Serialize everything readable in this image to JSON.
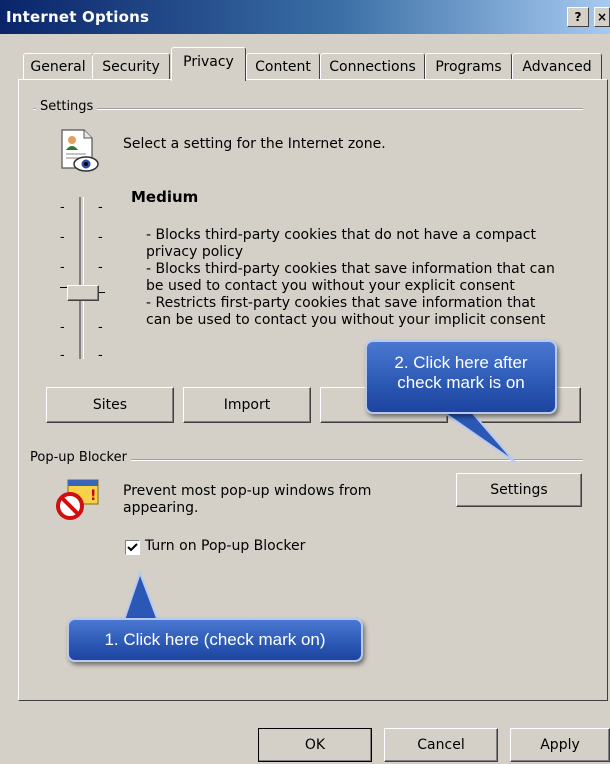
{
  "window": {
    "title": "Internet Options",
    "help_btn": "?",
    "close_btn": "×"
  },
  "tabs": [
    {
      "label": "General"
    },
    {
      "label": "Security"
    },
    {
      "label": "Privacy"
    },
    {
      "label": "Content"
    },
    {
      "label": "Connections"
    },
    {
      "label": "Programs"
    },
    {
      "label": "Advanced"
    }
  ],
  "active_tab": "Privacy",
  "settings": {
    "group_label": "Settings",
    "intro": "Select a setting for the Internet zone.",
    "level_title": "Medium",
    "desc": [
      "- Blocks third-party cookies that do not have a compact",
      "privacy policy",
      "- Blocks third-party cookies that save information that can",
      "be used to contact you without your explicit consent",
      "- Restricts first-party cookies that save information that",
      "can be used to contact you without your implicit consent"
    ],
    "buttons": {
      "sites": "Sites",
      "import": "Import",
      "advanced": "Ad"
    }
  },
  "popup": {
    "group_label": "Pop-up Blocker",
    "desc_line1": "Prevent most pop-up windows from",
    "desc_line2": "appearing.",
    "settings_btn": "Settings",
    "checkbox_label": "Turn on Pop-up Blocker",
    "checkbox_checked": true
  },
  "callouts": {
    "step2_line1": "2. Click here after",
    "step2_line2": "check mark is on",
    "step1": "1. Click here (check mark on)"
  },
  "footer": {
    "ok": "OK",
    "cancel": "Cancel",
    "apply": "Apply"
  }
}
